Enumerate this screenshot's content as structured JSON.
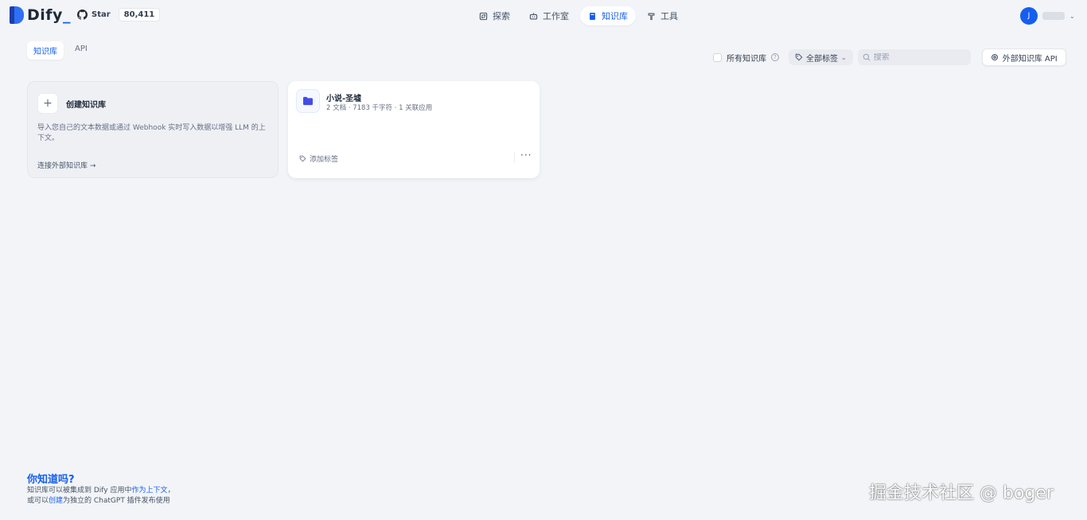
{
  "header": {
    "logo_text": "Dify",
    "logo_cursor": "_",
    "github": {
      "star_label": "Star",
      "star_count": "80,411"
    },
    "nav": [
      {
        "label": "探索",
        "icon": "compass-icon",
        "active": false
      },
      {
        "label": "工作室",
        "icon": "robot-icon",
        "active": false
      },
      {
        "label": "知识库",
        "icon": "book-icon",
        "active": true
      },
      {
        "label": "工具",
        "icon": "hammer-icon",
        "active": false
      }
    ],
    "user": {
      "avatar_letter": "J"
    }
  },
  "subtabs": [
    {
      "label": "知识库",
      "active": true
    },
    {
      "label": "API",
      "active": false
    }
  ],
  "filters": {
    "all_kb_label": "所有知识库",
    "help_glyph": "?",
    "tag_filter_label": "全部标签",
    "search_placeholder": "搜索",
    "external_api_label": "外部知识库 API"
  },
  "create_card": {
    "plus": "+",
    "title": "创建知识库",
    "description": "导入您自己的文本数据或通过 Webhook 实时写入数据以增强 LLM 的上下文。",
    "connect_link": "连接外部知识库 →"
  },
  "knowledge_bases": [
    {
      "name": "小说-圣墟",
      "meta": "2 文档 · 7183 千字符 · 1 关联应用",
      "add_tag_label": "添加标签",
      "more": "···"
    }
  ],
  "tip": {
    "title": "你知道吗?",
    "line1_prefix": "知识库可以被集成到 Dify 应用中",
    "line1_link": "作为上下文",
    "line1_suffix": "，",
    "line2_prefix": "或可以",
    "line2_link": "创建",
    "line2_suffix": "为独立的 ChatGPT 插件发布使用"
  },
  "watermark": "掘金技术社区 @ boger",
  "colors": {
    "accent": "#155eef",
    "background": "#f2f4f7"
  }
}
